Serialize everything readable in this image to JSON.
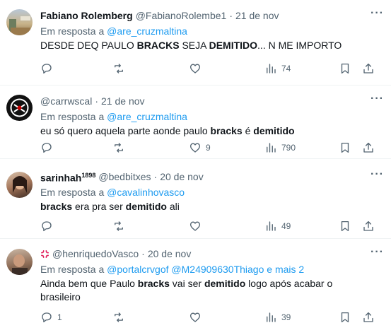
{
  "tweets": [
    {
      "name": "Fabiano Rolemberg",
      "handle": "@FabianoRolembe1",
      "sep": "·",
      "date": "21 de nov",
      "reply_prefix": "Em resposta a",
      "reply_to": "@are_cruzmaltina",
      "text_parts": [
        {
          "t": "DESDE DEQ PAULO ",
          "b": false
        },
        {
          "t": "BRACKS",
          "b": true
        },
        {
          "t": " SEJA ",
          "b": false
        },
        {
          "t": "DEMITIDO",
          "b": true
        },
        {
          "t": "... N ME IMPORTO",
          "b": false
        }
      ],
      "reply_count": "",
      "retweet_count": "",
      "like_count": "",
      "view_count": "74"
    },
    {
      "name": "",
      "handle": "@carrwscal",
      "sep": "·",
      "date": "21 de nov",
      "reply_prefix": "Em resposta a",
      "reply_to": "@are_cruzmaltina",
      "text_parts": [
        {
          "t": "eu só quero aquela parte aonde paulo ",
          "b": false
        },
        {
          "t": "bracks",
          "b": true
        },
        {
          "t": " é ",
          "b": false
        },
        {
          "t": "demitido",
          "b": true
        }
      ],
      "reply_count": "",
      "retweet_count": "",
      "like_count": "9",
      "view_count": "790"
    },
    {
      "name": "sarinhah",
      "name_sup": "1898",
      "handle": "@bedbitxes",
      "sep": "·",
      "date": "20 de nov",
      "reply_prefix": "Em resposta a",
      "reply_to": "@cavalinhovasco",
      "text_parts": [
        {
          "t": "bracks",
          "b": true
        },
        {
          "t": " era pra ser ",
          "b": false
        },
        {
          "t": "demitido",
          "b": true
        },
        {
          "t": " ali",
          "b": false
        }
      ],
      "reply_count": "",
      "retweet_count": "",
      "like_count": "",
      "view_count": "49"
    },
    {
      "name": "",
      "handle": "@henriquedoVasco",
      "sep": "·",
      "date": "20 de nov",
      "reply_prefix": "Em resposta a",
      "reply_to": "@portalcrvgof @M24909630Thiago e mais 2",
      "text_parts": [
        {
          "t": "Ainda bem que Paulo ",
          "b": false
        },
        {
          "t": "bracks",
          "b": true
        },
        {
          "t": " vai ser ",
          "b": false
        },
        {
          "t": "demitido",
          "b": true
        },
        {
          "t": " logo após acabar o brasileiro",
          "b": false
        }
      ],
      "reply_count": "1",
      "retweet_count": "",
      "like_count": "",
      "view_count": "39"
    }
  ],
  "icons": {
    "more": "more-horizontal-icon",
    "reply": "reply-bubble-icon",
    "retweet": "retweet-icon",
    "like": "heart-icon",
    "views": "views-bar-chart-icon",
    "bookmark": "bookmark-icon",
    "share": "share-upload-icon"
  },
  "more_glyph": "···",
  "colors": {
    "text": "#0f1419",
    "muted": "#536471",
    "link": "#1d9bf0",
    "badge": "#e0245e"
  }
}
